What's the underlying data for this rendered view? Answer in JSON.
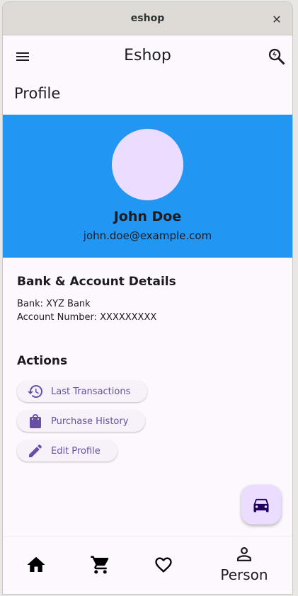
{
  "window": {
    "title": "eshop",
    "close_glyph": "✕"
  },
  "appbar": {
    "title": "Eshop"
  },
  "page": {
    "heading": "Profile"
  },
  "profile": {
    "name": "John Doe",
    "email": "john.doe@example.com"
  },
  "bank": {
    "title": "Bank & Account Details",
    "bank_line": "Bank: XYZ Bank",
    "account_line": "Account Number: XXXXXXXXX"
  },
  "actions": {
    "title": "Actions",
    "items": [
      {
        "label": "Last Transactions",
        "icon": "history-icon"
      },
      {
        "label": "Purchase History",
        "icon": "shopping-bag-icon"
      },
      {
        "label": "Edit Profile",
        "icon": "edit-icon"
      }
    ]
  },
  "fab": {
    "icon": "car-icon"
  },
  "bottom_nav": {
    "items": [
      {
        "icon": "home-icon"
      },
      {
        "icon": "cart-icon"
      },
      {
        "icon": "heart-icon"
      },
      {
        "icon": "person-icon",
        "label": "Person"
      }
    ]
  },
  "colors": {
    "hero": "#2196f3",
    "accent": "#6750a4",
    "avatar": "#eaddff"
  }
}
